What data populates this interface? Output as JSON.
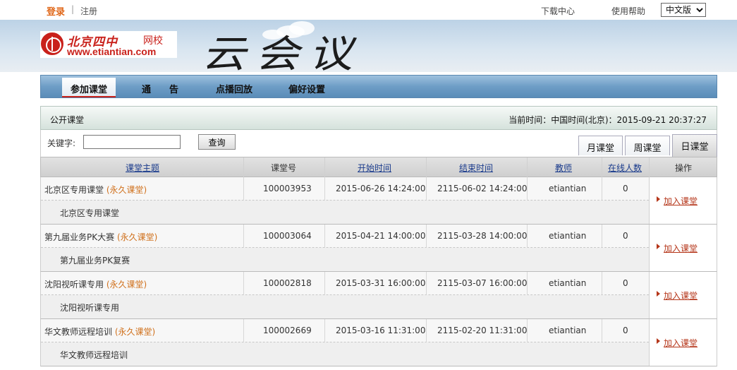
{
  "topbar": {
    "login": "登录",
    "separator": "|",
    "register": "注册",
    "download": "下载中心",
    "help": "使用帮助",
    "language": "中文版"
  },
  "banner": {
    "logo_name": "北京四中",
    "logo_school": "网校",
    "logo_url": "www.etiantian.com",
    "title": "云会议"
  },
  "nav": {
    "items": [
      "参加课堂",
      "通　　告",
      "点播回放",
      "偏好设置"
    ]
  },
  "public_class": {
    "title": "公开课堂",
    "time_text": "当前时间：中国时间(北京)：2015-09-21 20:37:27"
  },
  "search": {
    "label": "关键字:",
    "value": "",
    "button": "查询"
  },
  "tabs": [
    "月课堂",
    "周课堂",
    "日课堂"
  ],
  "table": {
    "headers": [
      "课堂主题",
      "课堂号",
      "开始时间",
      "结束时间",
      "教师",
      "在线人数",
      "操作"
    ],
    "permanent_label": "(永久课堂)",
    "join_label": "加入课堂",
    "rows": [
      {
        "topic": "北京区专用课堂",
        "id": "100003953",
        "start": "2015-06-26 14:24:00",
        "end": "2115-06-02 14:24:00",
        "teacher": "etiantian",
        "online": "0",
        "desc": "北京区专用课堂"
      },
      {
        "topic": "第九届业务PK大赛",
        "id": "100003064",
        "start": "2015-04-21 14:00:00",
        "end": "2115-03-28 14:00:00",
        "teacher": "etiantian",
        "online": "0",
        "desc": "第九届业务PK复赛"
      },
      {
        "topic": "沈阳视听课专用",
        "id": "100002818",
        "start": "2015-03-31 16:00:00",
        "end": "2115-03-07 16:00:00",
        "teacher": "etiantian",
        "online": "0",
        "desc": "沈阳视听课专用"
      },
      {
        "topic": "华文教师远程培训",
        "id": "100002669",
        "start": "2015-03-16 11:31:00",
        "end": "2115-02-20 11:31:00",
        "teacher": "etiantian",
        "online": "0",
        "desc": "华文教师远程培训"
      }
    ]
  }
}
